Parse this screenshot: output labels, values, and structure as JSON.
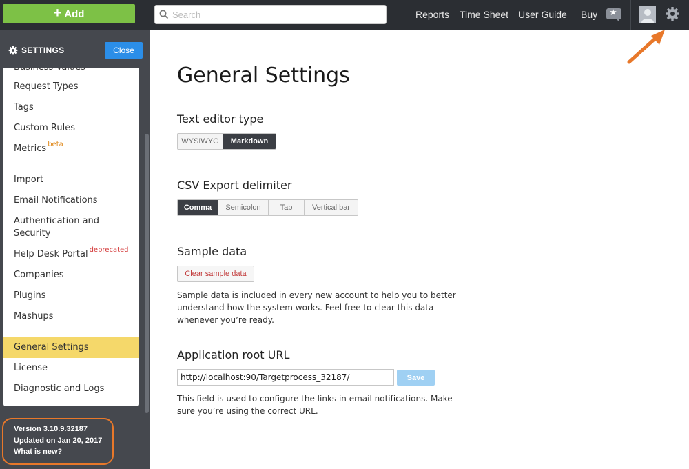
{
  "topbar": {
    "add_label": "Add",
    "search_placeholder": "Search",
    "links": [
      "Reports",
      "Time Sheet",
      "User Guide"
    ],
    "buy_label": "Buy"
  },
  "sidebar": {
    "header": "SETTINGS",
    "close_label": "Close",
    "partial_item": "Business Values",
    "items": [
      {
        "label": "Request Types"
      },
      {
        "label": "Tags"
      },
      {
        "label": "Custom Rules"
      },
      {
        "label": "Metrics",
        "badge": "beta"
      },
      {
        "label": "Import"
      },
      {
        "label": "Email Notifications"
      },
      {
        "label": "Authentication and Security"
      },
      {
        "label": "Help Desk Portal",
        "badge": "deprecated"
      },
      {
        "label": "Companies"
      },
      {
        "label": "Plugins"
      },
      {
        "label": "Mashups"
      },
      {
        "label": "General Settings",
        "active": true
      },
      {
        "label": "License"
      },
      {
        "label": "Diagnostic and Logs"
      }
    ],
    "version": {
      "version_text": "Version 3.10.9.32187",
      "updated_text": "Updated on Jan 20, 2017",
      "whats_new": "What is new?"
    }
  },
  "main": {
    "title": "General Settings",
    "text_editor": {
      "title": "Text editor type",
      "options": [
        "WYSIWYG",
        "Markdown"
      ],
      "selected": "Markdown"
    },
    "csv": {
      "title": "CSV Export delimiter",
      "options": [
        "Comma",
        "Semicolon",
        "Tab",
        "Vertical bar"
      ],
      "selected": "Comma"
    },
    "sample": {
      "title": "Sample data",
      "button": "Clear sample data",
      "description": "Sample data is included in every new account to help you to better understand how the system works. Feel free to clear this data whenever you’re ready."
    },
    "root_url": {
      "title": "Application root URL",
      "value": "http://localhost:90/Targetprocess_32187/",
      "save_label": "Save",
      "description": "This field is used to configure the links in email notifications. Make sure you’re using the correct URL."
    }
  },
  "colors": {
    "add_green": "#7dc146",
    "close_blue": "#2b8ee8",
    "active_yellow": "#f5d86a",
    "annotation_orange": "#e8782a"
  }
}
